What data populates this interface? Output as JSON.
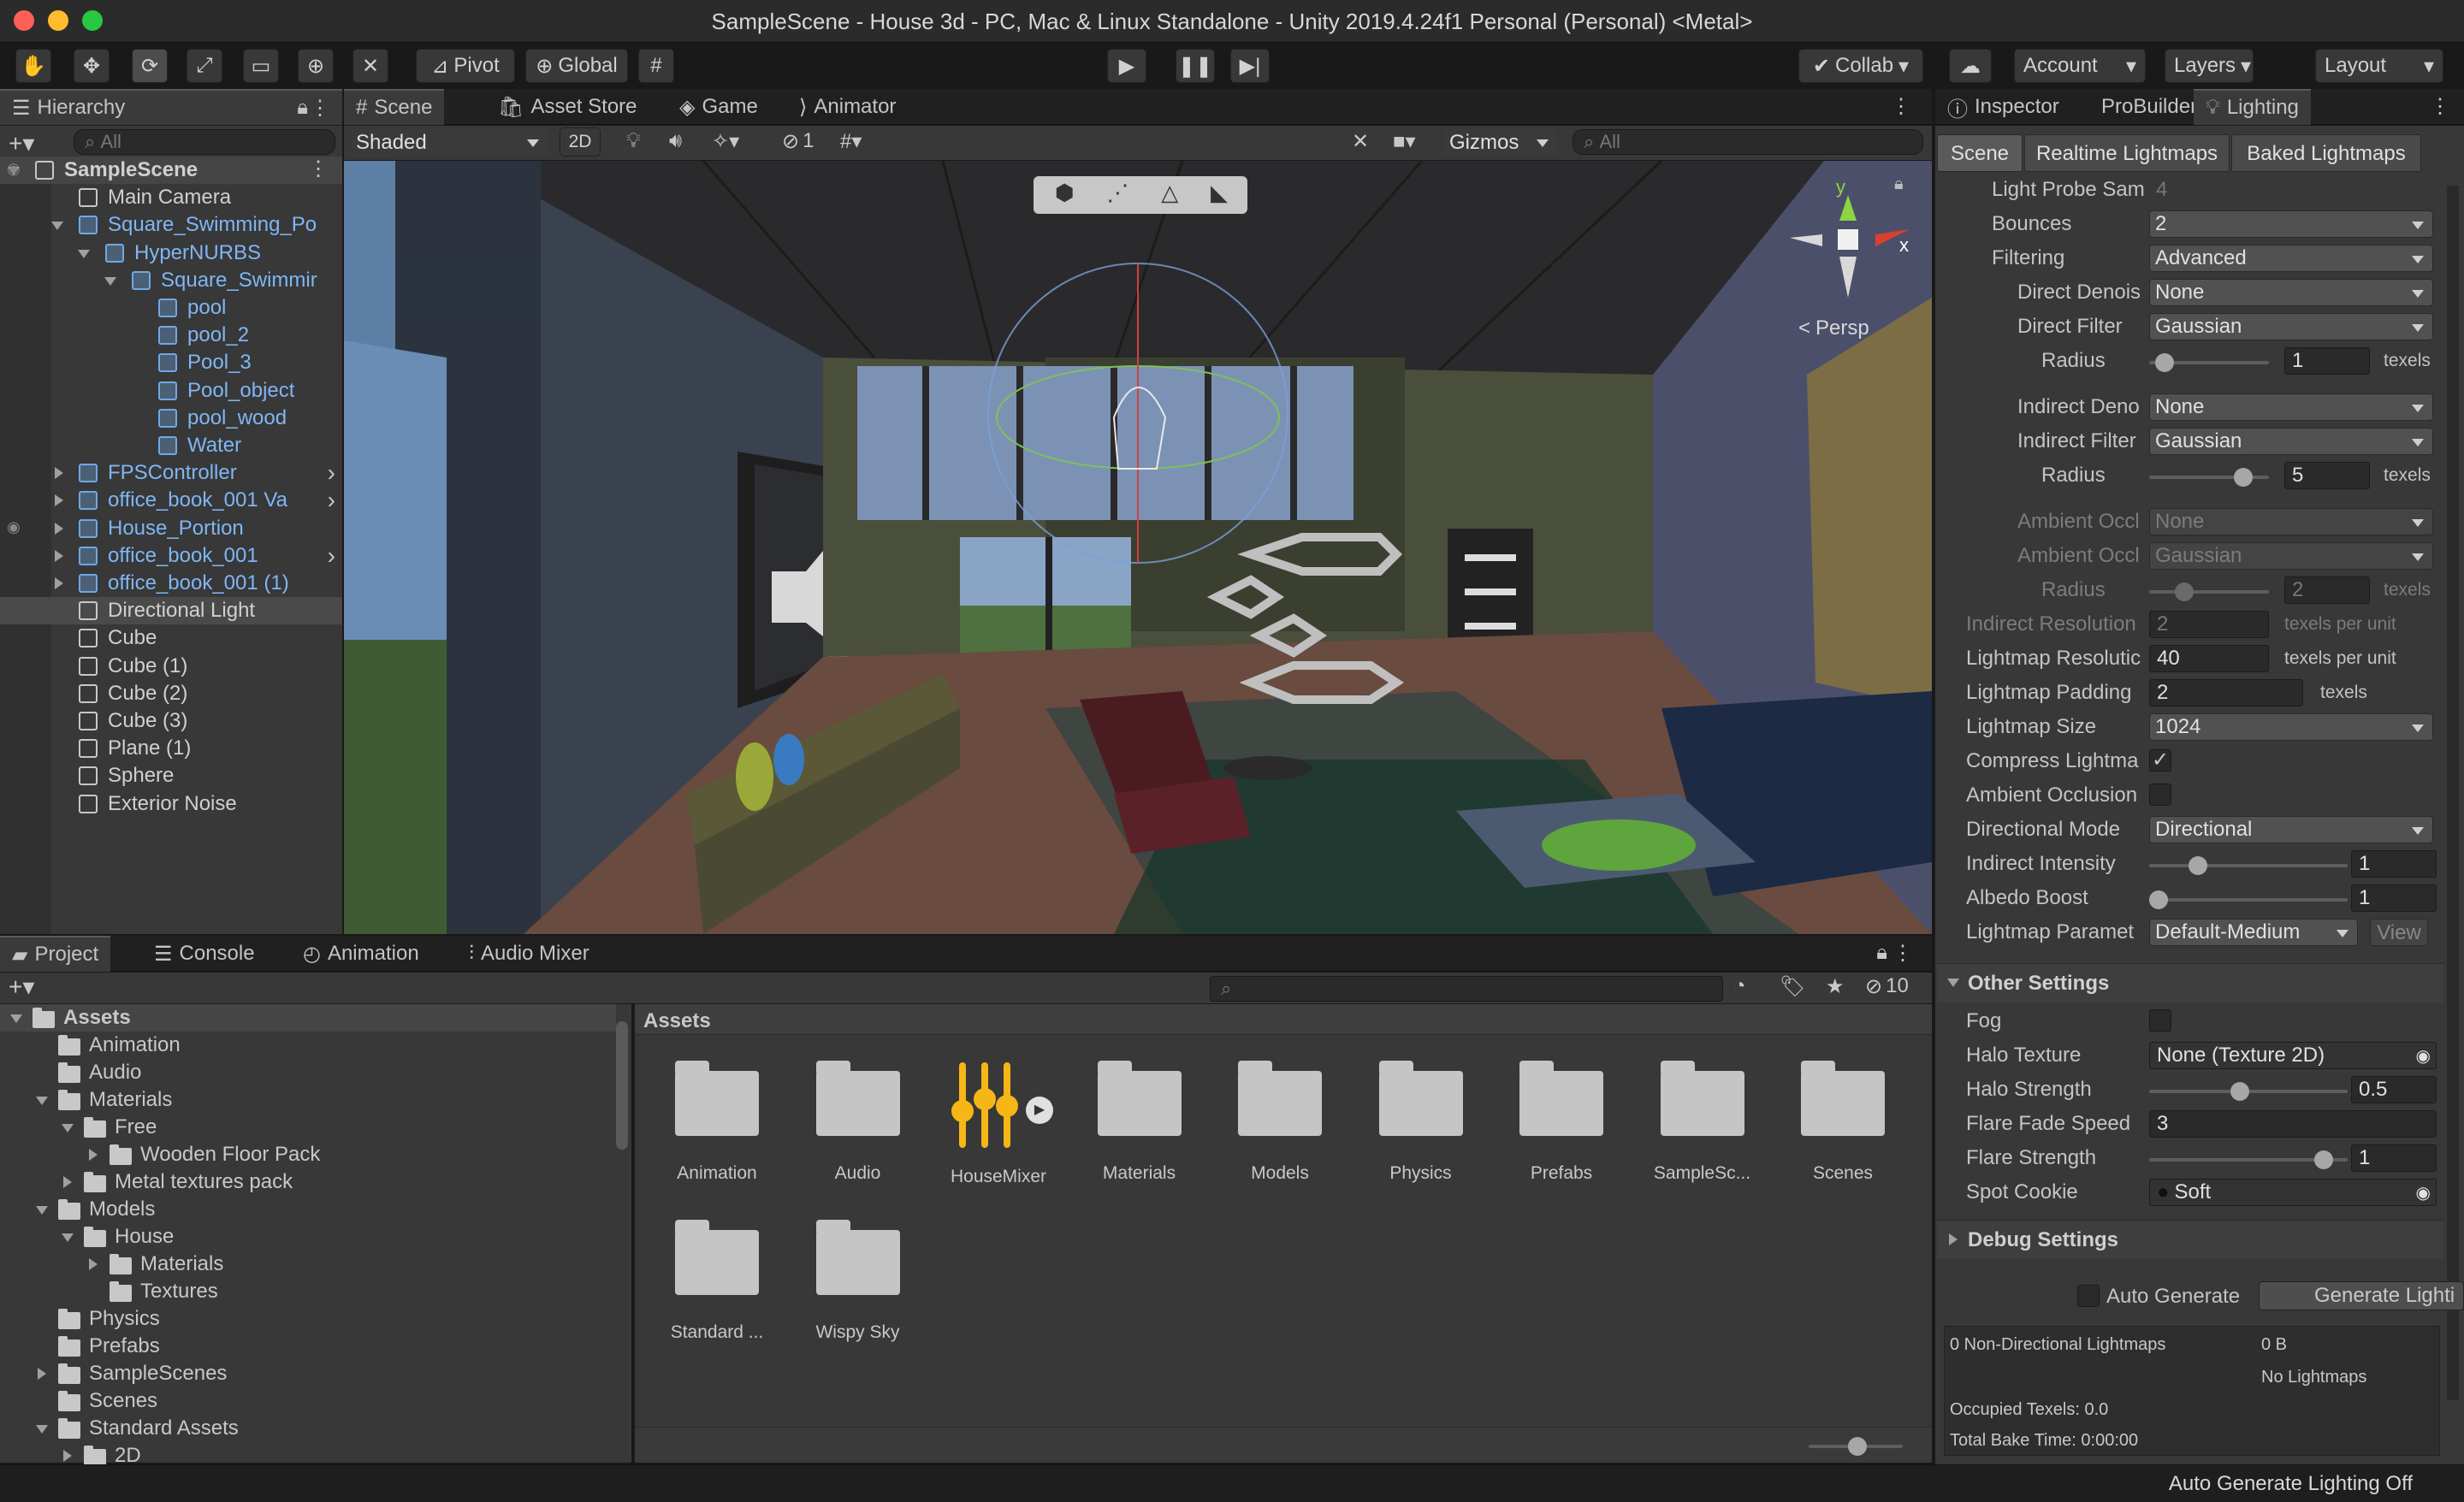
{
  "window": {
    "title": "SampleScene - House 3d - PC, Mac & Linux Standalone - Unity 2019.4.24f1 Personal (Personal) <Metal>"
  },
  "toolbar": {
    "pivot": "Pivot",
    "global": "Global",
    "collab": "Collab",
    "account": "Account",
    "layers": "Layers",
    "layout": "Layout"
  },
  "hierarchy": {
    "tab": "Hierarchy",
    "search_placeholder": "All",
    "items": [
      {
        "label": "SampleScene",
        "indent": 0,
        "type": "scene"
      },
      {
        "label": "Main Camera",
        "indent": 1,
        "type": "obj"
      },
      {
        "label": "Square_Swimming_Po",
        "indent": 1,
        "type": "prefab"
      },
      {
        "label": "HyperNURBS",
        "indent": 2,
        "type": "prefab"
      },
      {
        "label": "Square_Swimmir",
        "indent": 3,
        "type": "prefab"
      },
      {
        "label": "pool",
        "indent": 4,
        "type": "prefab"
      },
      {
        "label": "pool_2",
        "indent": 4,
        "type": "prefab"
      },
      {
        "label": "Pool_3",
        "indent": 4,
        "type": "prefab"
      },
      {
        "label": "Pool_object",
        "indent": 4,
        "type": "prefab"
      },
      {
        "label": "pool_wood",
        "indent": 4,
        "type": "prefab"
      },
      {
        "label": "Water",
        "indent": 4,
        "type": "prefab"
      },
      {
        "label": "FPSController",
        "indent": 1,
        "type": "prefab"
      },
      {
        "label": "office_book_001 Va",
        "indent": 1,
        "type": "prefab"
      },
      {
        "label": "House_Portion",
        "indent": 1,
        "type": "prefab"
      },
      {
        "label": "office_book_001",
        "indent": 1,
        "type": "prefab"
      },
      {
        "label": "office_book_001 (1)",
        "indent": 1,
        "type": "prefab"
      },
      {
        "label": "Directional Light",
        "indent": 1,
        "type": "obj"
      },
      {
        "label": "Cube",
        "indent": 1,
        "type": "obj"
      },
      {
        "label": "Cube (1)",
        "indent": 1,
        "type": "obj"
      },
      {
        "label": "Cube (2)",
        "indent": 1,
        "type": "obj"
      },
      {
        "label": "Cube (3)",
        "indent": 1,
        "type": "obj"
      },
      {
        "label": "Plane (1)",
        "indent": 1,
        "type": "obj"
      },
      {
        "label": "Sphere",
        "indent": 1,
        "type": "obj"
      },
      {
        "label": "Exterior Noise",
        "indent": 1,
        "type": "obj"
      }
    ]
  },
  "scene": {
    "tabs": [
      "Scene",
      "Asset Store",
      "Game",
      "Animator"
    ],
    "shading": "Shaded",
    "mode2d": "2D",
    "hidden_count": "1",
    "gizmos": "Gizmos",
    "search_placeholder": "All",
    "persp": "Persp",
    "axis_y": "y",
    "axis_x": "x"
  },
  "inspector": {
    "tabs": [
      "Inspector",
      "ProBuilder",
      "Lighting"
    ],
    "subtabs": [
      "Scene",
      "Realtime Lightmaps",
      "Baked Lightmaps"
    ],
    "rows": [
      {
        "label": "Light Probe Sam",
        "value": "4",
        "kind": "field"
      },
      {
        "label": "Bounces",
        "value": "2",
        "kind": "dd"
      },
      {
        "label": "Filtering",
        "value": "Advanced",
        "kind": "dd"
      },
      {
        "label": "Direct Denois",
        "value": "None",
        "kind": "dd"
      },
      {
        "label": "Direct Filter",
        "value": "Gaussian",
        "kind": "dd"
      },
      {
        "label": "Radius",
        "value": "1",
        "unit": "texels",
        "kind": "slider"
      },
      {
        "label": "Indirect Deno",
        "value": "None",
        "kind": "dd"
      },
      {
        "label": "Indirect Filter",
        "value": "Gaussian",
        "kind": "dd"
      },
      {
        "label": "Radius",
        "value": "5",
        "unit": "texels",
        "kind": "slider"
      },
      {
        "label": "Ambient Occl",
        "value": "None",
        "kind": "dd"
      },
      {
        "label": "Ambient Occl",
        "value": "Gaussian",
        "kind": "dd"
      },
      {
        "label": "Radius",
        "value": "2",
        "unit": "texels",
        "kind": "slider"
      },
      {
        "label": "Indirect Resolution",
        "value": "2",
        "unit": "texels per unit",
        "kind": "field"
      },
      {
        "label": "Lightmap Resolutic",
        "value": "40",
        "unit": "texels per unit",
        "kind": "field"
      },
      {
        "label": "Lightmap Padding",
        "value": "2",
        "unit": "texels",
        "kind": "field"
      },
      {
        "label": "Lightmap Size",
        "value": "1024",
        "kind": "dd"
      },
      {
        "label": "Compress Lightma",
        "value": "✓",
        "kind": "check"
      },
      {
        "label": "Ambient Occlusion",
        "value": "",
        "kind": "check"
      },
      {
        "label": "Directional Mode",
        "value": "Directional",
        "kind": "dd"
      },
      {
        "label": "Indirect Intensity",
        "value": "1",
        "kind": "slider"
      },
      {
        "label": "Albedo Boost",
        "value": "1",
        "kind": "slider"
      },
      {
        "label": "Lightmap Paramet",
        "value": "Default-Medium",
        "kind": "dd"
      }
    ],
    "view_button": "View",
    "other_settings": "Other Settings",
    "other_rows": [
      {
        "label": "Fog",
        "value": ""
      },
      {
        "label": "Halo Texture",
        "value": "None (Texture 2D)"
      },
      {
        "label": "Halo Strength",
        "value": "0.5"
      },
      {
        "label": "Flare Fade Speed",
        "value": "3"
      },
      {
        "label": "Flare Strength",
        "value": "1"
      },
      {
        "label": "Spot Cookie",
        "value": "Soft"
      }
    ],
    "debug_settings": "Debug Settings",
    "auto_generate": "Auto Generate",
    "generate_button": "Generate Lighti",
    "stats": {
      "non_directional": "0 Non-Directional Lightmaps",
      "size": "0 B",
      "no_lightmaps": "No Lightmaps",
      "occupied": "Occupied Texels: 0.0",
      "bake_time": "Total Bake Time: 0:00:00"
    }
  },
  "project": {
    "tabs": [
      "Project",
      "Console",
      "Animation",
      "Audio Mixer"
    ],
    "hidden_count": "10",
    "tree": [
      {
        "label": "Assets",
        "indent": 0,
        "open": true
      },
      {
        "label": "Animation",
        "indent": 1,
        "open": null
      },
      {
        "label": "Audio",
        "indent": 1,
        "open": null
      },
      {
        "label": "Materials",
        "indent": 1,
        "open": true
      },
      {
        "label": "Free",
        "indent": 2,
        "open": true
      },
      {
        "label": "Wooden Floor Pack",
        "indent": 3,
        "open": false
      },
      {
        "label": "Metal textures pack",
        "indent": 2,
        "open": false
      },
      {
        "label": "Models",
        "indent": 1,
        "open": true
      },
      {
        "label": "House",
        "indent": 2,
        "open": true
      },
      {
        "label": "Materials",
        "indent": 3,
        "open": false
      },
      {
        "label": "Textures",
        "indent": 3,
        "open": null
      },
      {
        "label": "Physics",
        "indent": 1,
        "open": null
      },
      {
        "label": "Prefabs",
        "indent": 1,
        "open": null
      },
      {
        "label": "SampleScenes",
        "indent": 1,
        "open": false
      },
      {
        "label": "Scenes",
        "indent": 1,
        "open": null
      },
      {
        "label": "Standard Assets",
        "indent": 1,
        "open": true
      },
      {
        "label": "2D",
        "indent": 2,
        "open": false
      }
    ],
    "breadcrumb": "Assets",
    "assets": [
      "Animation",
      "Audio",
      "HouseMixer",
      "Materials",
      "Models",
      "Physics",
      "Prefabs",
      "SampleSc...",
      "Scenes",
      "Standard ...",
      "Wispy Sky"
    ]
  },
  "status": {
    "text": "Auto Generate Lighting Off"
  }
}
